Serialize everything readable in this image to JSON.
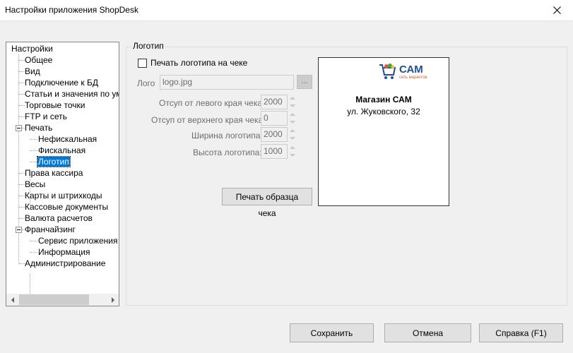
{
  "window": {
    "title": "Настройки приложения ShopDesk"
  },
  "tree": {
    "root": "Настройки",
    "items": [
      "Общее",
      "Вид",
      "Подключение к БД",
      "Статьи и значения по умо...",
      "Торговые точки",
      "FTP и сеть",
      "Печать",
      "Нефискальная",
      "Фискальная",
      "Логотип",
      "Права кассира",
      "Весы",
      "Карты и штрихкоды",
      "Кассовые документы",
      "Валюта расчетов",
      "Франчайзинг",
      "Сервис приложения",
      "Информация",
      "Администрирование"
    ],
    "selected": "Логотип"
  },
  "logo_panel": {
    "group_title": "Логотип",
    "print_logo_label": "Печать логотипа на чеке",
    "print_logo_checked": false,
    "logo_label": "Лого",
    "logo_value": "logo.jpg",
    "browse_label": "...",
    "left_offset_label": "Отсуп от левого края чека:",
    "left_offset_value": "2000",
    "top_offset_label": "Отсуп от верхнего края чека:",
    "top_offset_value": "0",
    "width_label": "Ширина логотипа:",
    "width_value": "2000",
    "height_label": "Высота логотипа:",
    "height_value": "1000",
    "print_sample_label": "Печать образца чека"
  },
  "preview": {
    "logo_text": "САМ",
    "logo_subtext": "сеть маркетов",
    "shop_name": "Магазин САМ",
    "shop_address": "ул. Жуковского, 32"
  },
  "buttons": {
    "save": "Сохранить",
    "cancel": "Отмена",
    "help": "Справка (F1)"
  },
  "colors": {
    "selection": "#0078d7",
    "logo_blue": "#1f4e99",
    "logo_orange": "#e25b2d"
  }
}
